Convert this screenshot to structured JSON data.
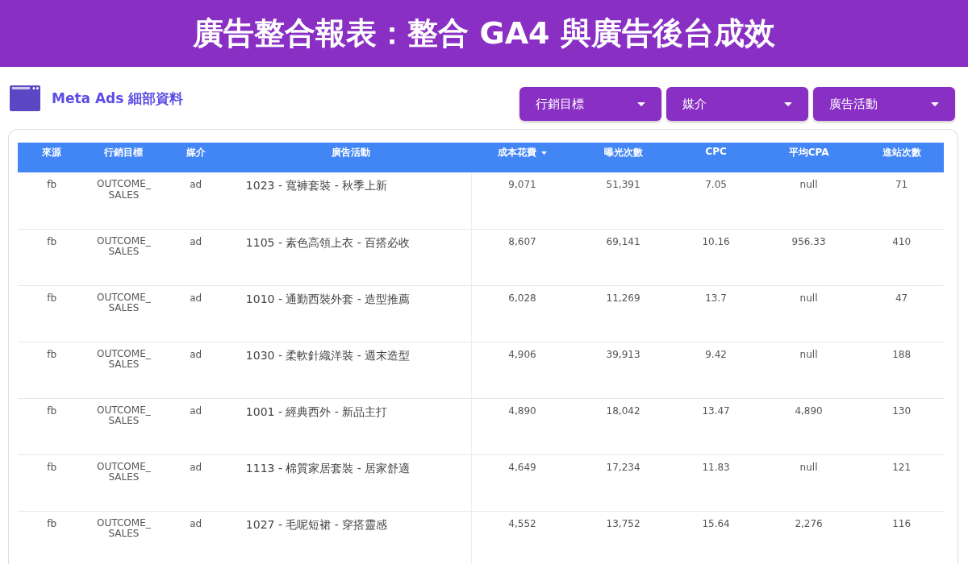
{
  "banner": {
    "title": "廣告整合報表：整合 GA4 與廣告後台成效"
  },
  "section": {
    "title": "Meta Ads 細部資料"
  },
  "filters": [
    {
      "label": "行銷目標"
    },
    {
      "label": "媒介"
    },
    {
      "label": "廣告活動"
    }
  ],
  "table": {
    "columns": [
      {
        "label": "來源",
        "sorted": false
      },
      {
        "label": "行銷目標",
        "sorted": false
      },
      {
        "label": "媒介",
        "sorted": false
      },
      {
        "label": "廣告活動",
        "sorted": false
      },
      {
        "label": "成本花費",
        "sorted": true
      },
      {
        "label": "曝光次數",
        "sorted": false
      },
      {
        "label": "CPC",
        "sorted": false
      },
      {
        "label": "平均CPA",
        "sorted": false
      },
      {
        "label": "進站次數",
        "sorted": false
      }
    ],
    "rows": [
      [
        "fb",
        "OUTCOME_SALES",
        "ad",
        "1023 - 寬褲套裝 - 秋季上新",
        "9,071",
        "51,391",
        "7.05",
        "null",
        "71"
      ],
      [
        "fb",
        "OUTCOME_SALES",
        "ad",
        "1105 - 素色高領上衣 - 百搭必收",
        "8,607",
        "69,141",
        "10.16",
        "956.33",
        "410"
      ],
      [
        "fb",
        "OUTCOME_SALES",
        "ad",
        "1010 - 通勤西裝外套 - 造型推薦",
        "6,028",
        "11,269",
        "13.7",
        "null",
        "47"
      ],
      [
        "fb",
        "OUTCOME_SALES",
        "ad",
        "1030 - 柔軟針織洋裝 - 週末造型",
        "4,906",
        "39,913",
        "9.42",
        "null",
        "188"
      ],
      [
        "fb",
        "OUTCOME_SALES",
        "ad",
        "1001 - 經典西外 - 新品主打",
        "4,890",
        "18,042",
        "13.47",
        "4,890",
        "130"
      ],
      [
        "fb",
        "OUTCOME_SALES",
        "ad",
        "1113 - 棉質家居套裝 - 居家舒適",
        "4,649",
        "17,234",
        "11.83",
        "null",
        "121"
      ],
      [
        "fb",
        "OUTCOME_SALES",
        "ad",
        "1027 - 毛呢短裙 - 穿搭靈感",
        "4,552",
        "13,752",
        "15.64",
        "2,276",
        "116"
      ]
    ]
  }
}
